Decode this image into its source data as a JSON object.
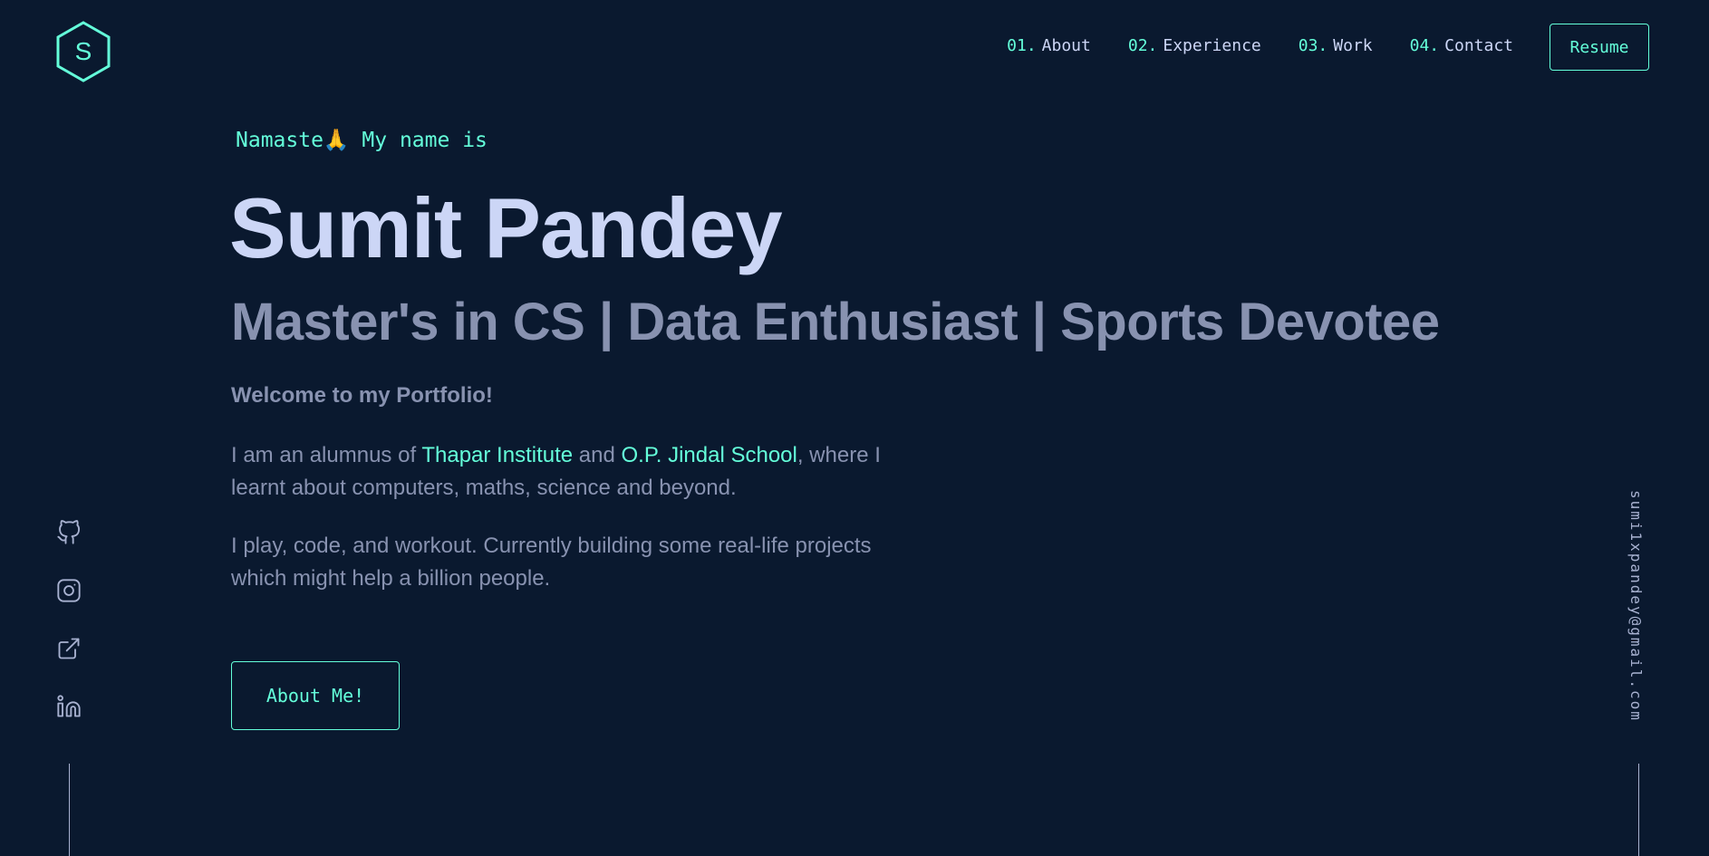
{
  "header": {
    "logo_letter": "S",
    "nav": [
      {
        "num": "01.",
        "label": "About"
      },
      {
        "num": "02.",
        "label": "Experience"
      },
      {
        "num": "03.",
        "label": "Work"
      },
      {
        "num": "04.",
        "label": "Contact"
      }
    ],
    "resume_label": "Resume"
  },
  "hero": {
    "greeting": "Namaste🙏 My name is",
    "name": "Sumit Pandey",
    "tagline": "Master's in CS | Data Enthusiast | Sports Devotee",
    "welcome": "Welcome to my Portfolio!",
    "bio1": {
      "pre": "I am an alumnus of ",
      "link1": "Thapar Institute",
      "mid": " and ",
      "link2": "O.P. Jindal School",
      "post": ", where I learnt about computers, maths, science and beyond."
    },
    "bio2": "I play, code, and workout. Currently building some real-life projects which might help a billion people.",
    "cta_label": "About Me!"
  },
  "social": {
    "icons": [
      "github-icon",
      "instagram-icon",
      "external-link-icon",
      "linkedin-icon"
    ]
  },
  "email": "sumi1xpandey@gmail.com",
  "colors": {
    "background": "#0a192f",
    "accent": "#64ffda",
    "heading": "#ccd6f6",
    "text": "#8892b0",
    "icon": "#a8b2d1"
  }
}
